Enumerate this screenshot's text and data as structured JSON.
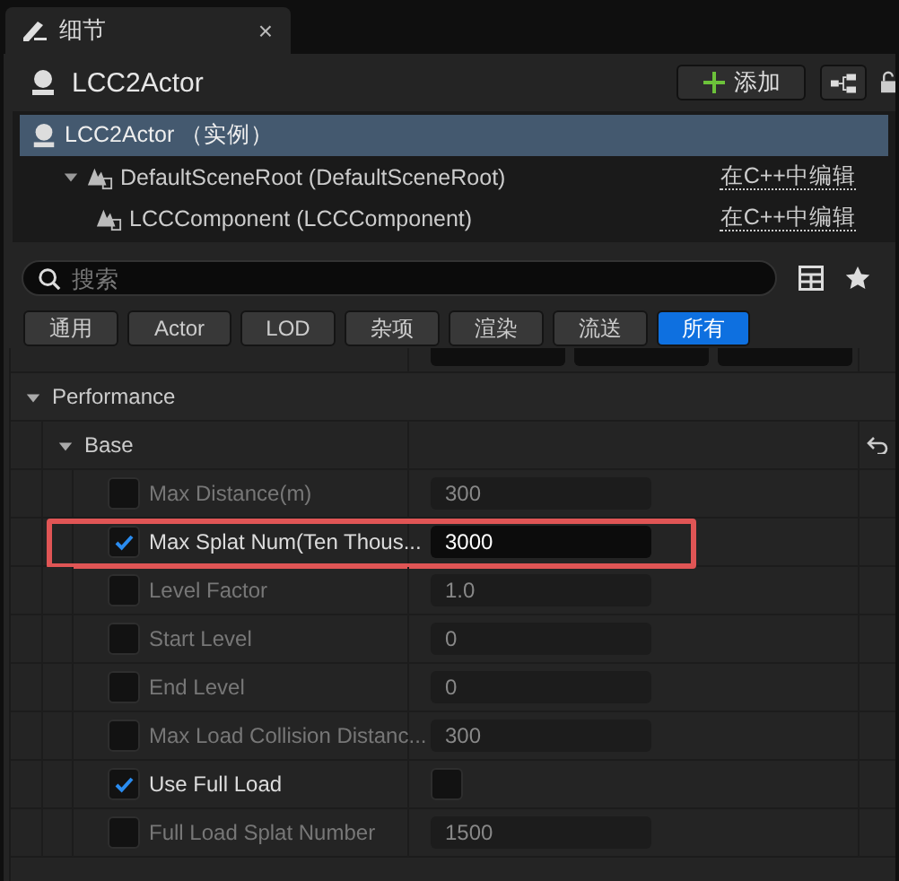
{
  "tab": {
    "title": "细节",
    "close": "×"
  },
  "actor": {
    "name": "LCC2Actor",
    "add_button": "添加"
  },
  "components": [
    {
      "label": "LCC2Actor （实例）",
      "selected": true,
      "children": [
        {
          "label": "DefaultSceneRoot (DefaultSceneRoot)",
          "action": "在C++中编辑",
          "selected": false,
          "expanded": true,
          "children": [
            {
              "label": "LCCComponent (LCCComponent)",
              "action": "在C++中编辑",
              "selected": false
            }
          ]
        }
      ]
    }
  ],
  "search": {
    "placeholder": "搜索"
  },
  "filters": [
    {
      "label": "通用",
      "selected": false
    },
    {
      "label": "Actor",
      "selected": false
    },
    {
      "label": "LOD",
      "selected": false
    },
    {
      "label": "杂项",
      "selected": false
    },
    {
      "label": "渲染",
      "selected": false
    },
    {
      "label": "流送",
      "selected": false
    },
    {
      "label": "所有",
      "selected": true
    }
  ],
  "category": {
    "label": "Performance",
    "expanded": true,
    "group": {
      "label": "Base",
      "expanded": true,
      "properties": [
        {
          "label": "Max Distance(m)",
          "override": false,
          "kind": "number",
          "value": "300",
          "highlighted": false
        },
        {
          "label": "Max Splat Num(Ten Thous...",
          "override": true,
          "kind": "number",
          "value": "3000",
          "highlighted": true
        },
        {
          "label": "Level Factor",
          "override": false,
          "kind": "number",
          "value": "1.0",
          "highlighted": false
        },
        {
          "label": "Start Level",
          "override": false,
          "kind": "number",
          "value": "0",
          "highlighted": false
        },
        {
          "label": "End Level",
          "override": false,
          "kind": "number",
          "value": "0",
          "highlighted": false
        },
        {
          "label": "Max Load Collision Distanc...",
          "override": false,
          "kind": "number",
          "value": "300",
          "highlighted": false
        },
        {
          "label": "Use Full Load",
          "override": true,
          "kind": "bool",
          "checked": false,
          "highlighted": false
        },
        {
          "label": "Full Load Splat Number",
          "override": false,
          "kind": "number",
          "value": "1500",
          "highlighted": false
        }
      ]
    }
  }
}
